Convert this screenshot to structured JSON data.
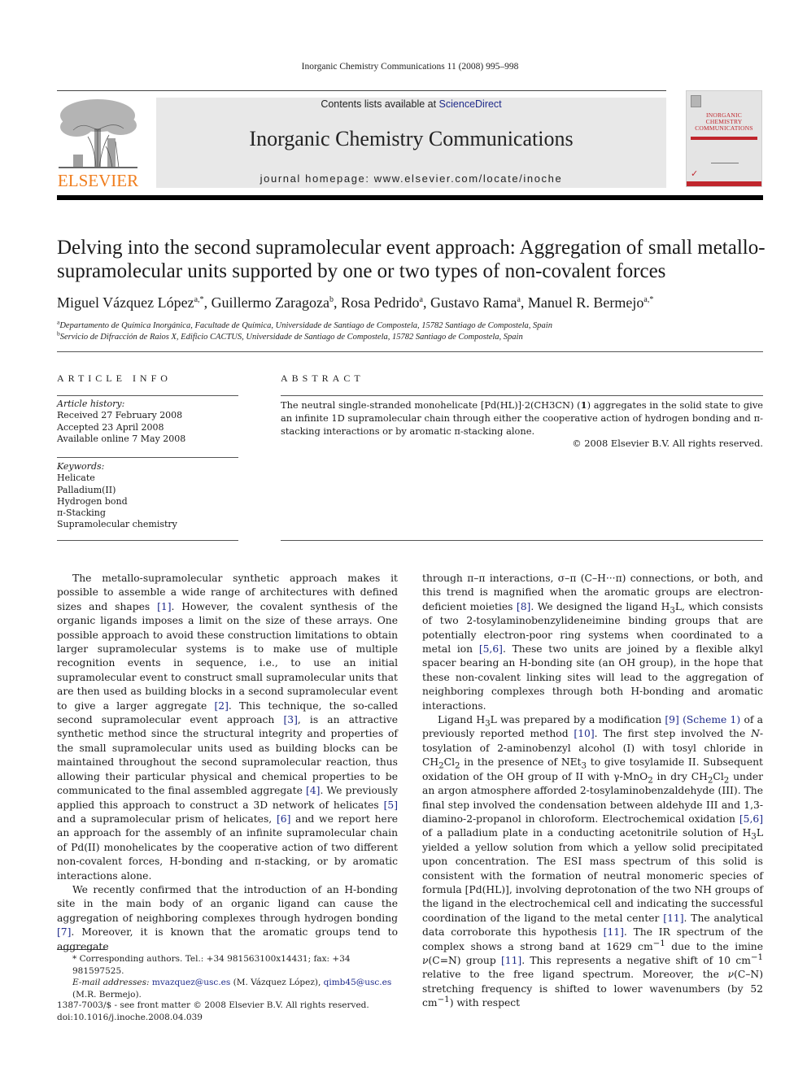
{
  "running_head": "Inorganic Chemistry Communications 11 (2008) 995–998",
  "header": {
    "publisher_logo_text": "ELSEVIER",
    "contents_prefix": "Contents lists available at ",
    "contents_link": "ScienceDirect",
    "journal_title": "Inorganic Chemistry Communications",
    "homepage": "journal homepage: www.elsevier.com/locate/inoche",
    "cover_title_lines": [
      "INORGANIC",
      "CHEMISTRY",
      "COMMUNICATIONS"
    ],
    "colors": {
      "elsevier_orange": "#f07d1c",
      "link_blue": "#1e2a8a",
      "banner_gray": "#e8e8e8",
      "cover_red": "#c0262d"
    }
  },
  "article": {
    "title": "Delving into the second supramolecular event approach: Aggregation of small metallo-supramolecular units supported by one or two types of non-covalent forces",
    "authors": [
      {
        "name": "Miguel Vázquez López",
        "sup": "a,*",
        "sep": ", "
      },
      {
        "name": "Guillermo Zaragoza",
        "sup": "b",
        "sep": ", "
      },
      {
        "name": "Rosa Pedrido",
        "sup": "a",
        "sep": ", "
      },
      {
        "name": "Gustavo Rama",
        "sup": "a",
        "sep": ", "
      },
      {
        "name": "Manuel R. Bermejo",
        "sup": "a,*",
        "sep": ""
      }
    ],
    "affiliations": [
      {
        "mark": "a",
        "text": "Departamento de Química Inorgánica, Facultade de Química, Universidade de Santiago de Compostela, 15782 Santiago de Compostela, Spain"
      },
      {
        "mark": "b",
        "text": "Servicio de Difracción de Raios X, Edificio CACTUS, Universidade de Santiago de Compostela, 15782 Santiago de Compostela, Spain"
      }
    ]
  },
  "article_info": {
    "heading": "ARTICLE INFO",
    "history_label": "Article history:",
    "history": [
      "Received 27 February 2008",
      "Accepted 23 April 2008",
      "Available online 7 May 2008"
    ],
    "keywords_label": "Keywords:",
    "keywords": [
      "Helicate",
      "Palladium(II)",
      "Hydrogen bond",
      "π-Stacking",
      "Supramolecular chemistry"
    ]
  },
  "abstract": {
    "heading": "ABSTRACT",
    "text_before_bold": "The neutral single-stranded monohelicate [Pd(HL)]·2(CH3CN) (",
    "bold": "1",
    "text_after_bold": ") aggregates in the solid state to give an infinite 1D supramolecular chain through either the cooperative action of hydrogen bonding and π-stack­ing interactions or by aromatic π-stacking alone.",
    "copyright": "© 2008 Elsevier B.V. All rights reserved."
  },
  "body": {
    "left": {
      "p1": [
        "The metallo-supramolecular synthetic approach makes it possible to assemble a wide range of architectures with defined sizes and shapes ",
        "[1]",
        ". However, the covalent synthesis of the organic ligands imposes a limit on the size of these arrays. One possible approach to avoid these construction limitations to obtain larger supramolecular systems is to make use of multiple recognition events in sequence, i.e., to use an initial supramolecular event to construct small supramolecular units that are then used as building blocks in a second supramolecular event to give a larger aggregate ",
        "[2]",
        ". This technique, the so-called second supramolecular event approach ",
        "[3]",
        ", is an attractive synthetic method since the structural integrity and properties of the small supramolecular units used as building blocks can be maintained throughout the second supramolecular reaction, thus allowing their particular physical and chemical properties to be communicated to the final assembled aggregate ",
        "[4]",
        ". We previously applied this approach to construct a 3D network of helicates ",
        "[5]",
        " and a supramolecular prism of helicates, ",
        "[6]",
        " and we report here an approach for the assembly of an infinite supramolecular chain of Pd(II) monohelicates by the cooperative action of two different non-covalent forces, H-bonding and π-stacking, or by aromatic interactions alone."
      ],
      "p2": [
        "We recently confirmed that the introduction of an H-bonding site in the main body of an organic ligand can cause the aggregation of neighboring complexes through hydrogen bonding ",
        "[7]",
        ". Moreover, it is known that the aromatic groups tend to aggregate"
      ]
    },
    "right": {
      "p1": [
        "through π–π interactions, σ–π (C–H···π) connections, or both, and this trend is magnified when the aromatic groups are electron-deficient moieties ",
        "[8]",
        ". We designed the ligand H",
        "3",
        "L, which consists of two 2-tosylaminobenzylideneimine binding groups that are potentially electron-poor ring systems when coordinated to a metal ion ",
        "[5,6]",
        ". These two units are joined by a flexible alkyl spacer bearing an H-bonding site (an OH group), in the hope that these non-covalent linking sites will lead to the aggregation of neighboring complexes through both H-bonding and aromatic interactions."
      ],
      "p2": {
        "a": "Ligand H",
        "a_sub": "3",
        "b": "L was prepared by a modification ",
        "ref9": "[9]",
        "scheme": "(Scheme 1)",
        "c": " of a previously reported method ",
        "ref10": "[10]",
        "d": ". The first step involved the ",
        "d_it": "N",
        "e": "-tosylation of 2-aminobenzyl alcohol (I) with tosyl chloride in CH",
        "e_sub1": "2",
        "e2": "Cl",
        "e_sub2": "2",
        "f": " in the presence of NEt",
        "f_sub": "3",
        "g": " to give tosylamide II. Subsequent oxidation of the OH group of II with γ-MnO",
        "g_sub": "2",
        "h": " in dry CH",
        "h_sub1": "2",
        "h2": "Cl",
        "h_sub2": "2",
        "i": " under an argon atmosphere afforded 2-tosylaminobenzaldehyde (III). The final step involved the condensation between aldehyde III and 1,3-diamino-2-propanol in chloroform. Electrochemical oxidation ",
        "ref56": "[5,6]",
        "j": " of a palladium plate in a conducting acetonitrile solution of H",
        "j_sub": "3",
        "k": "L yielded a yellow solution from which a yellow solid precipitated upon concentration. The ESI mass spectrum of this solid is consistent with the formation of neutral monomeric species of formula [Pd(HL)], involving deprotonation of the two NH groups of the ligand in the electrochemical cell and indicating the successful coordination of the ligand to the metal center ",
        "ref11a": "[11]",
        "l": ". The analytical data corroborate this hypothesis ",
        "ref11b": "[11]",
        "m": ". The IR spectrum of the complex shows a strong band at 1629 cm",
        "m_sup": "−1",
        "n": " due to the imine ",
        "n_it": "ν",
        "o": "(C=N) group ",
        "ref11c": "[11]",
        "p": ". This represents a negative shift of 10 cm",
        "p_sup": "−1",
        "q": " relative to the free ligand spectrum. Moreover, the ",
        "q_it": "ν",
        "r": "(C–N) stretching frequency is shifted to lower wavenumbers (by 52 cm",
        "r_sup": "−1",
        "s": ") with respect"
      }
    }
  },
  "footnote": {
    "star_line": "* Corresponding authors. Tel.: +34 981563100x14431; fax: +34 981597525.",
    "email_label": "E-mail addresses:",
    "email1": "mvazquez@usc.es",
    "email1_owner": " (M. Vázquez López), ",
    "email2": "qimb45@usc.es",
    "email2_owner": " (M.R. Bermejo)."
  },
  "front_matter": {
    "issn_line": "1387-7003/$ - see front matter © 2008 Elsevier B.V. All rights reserved.",
    "doi": "doi:10.1016/j.inoche.2008.04.039"
  }
}
